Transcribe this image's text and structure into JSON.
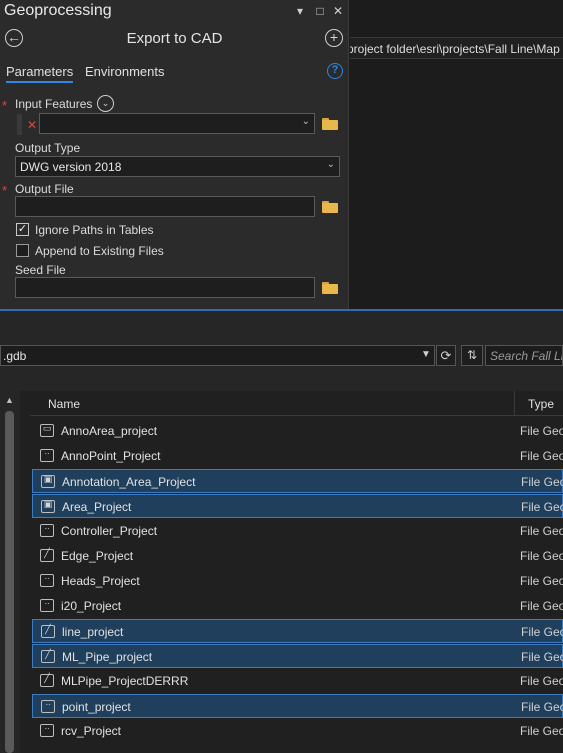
{
  "geoprocessing": {
    "title": "Geoprocessing",
    "tool_name": "Export to CAD",
    "tabs": [
      "Parameters",
      "Environments"
    ],
    "params": {
      "input_features_label": "Input Features",
      "output_type_label": "Output Type",
      "output_type_value": "DWG version 2018",
      "output_file_label": "Output File",
      "ignore_paths_label": "Ignore Paths in Tables",
      "ignore_paths_checked": true,
      "append_label": "Append to Existing Files",
      "append_checked": false,
      "seed_file_label": "Seed File"
    }
  },
  "map": {
    "path": "project folder\\esri\\projects\\Fall Line\\Map"
  },
  "catalog": {
    "address": ".gdb",
    "search_placeholder": "Search Fall Line",
    "columns": {
      "name": "Name",
      "type": "Type"
    },
    "rows": [
      {
        "name": "AnnoArea_project",
        "type": "File Geo",
        "icon": "polygon-fc-icon",
        "selected": false
      },
      {
        "name": "AnnoPoint_Project",
        "type": "File Geo",
        "icon": "point-fc-icon",
        "selected": false
      },
      {
        "name": "Annotation_Area_Project",
        "type": "File Geo",
        "icon": "annotation-fc-icon",
        "selected": true
      },
      {
        "name": "Area_Project",
        "type": "File Geo",
        "icon": "annotation-fc-icon",
        "selected": true
      },
      {
        "name": "Controller_Project",
        "type": "File Geo",
        "icon": "point-fc-icon",
        "selected": false
      },
      {
        "name": "Edge_Project",
        "type": "File Geo",
        "icon": "line-fc-icon",
        "selected": false
      },
      {
        "name": "Heads_Project",
        "type": "File Geo",
        "icon": "point-fc-icon",
        "selected": false
      },
      {
        "name": "i20_Project",
        "type": "File Geo",
        "icon": "point-fc-icon",
        "selected": false
      },
      {
        "name": "line_project",
        "type": "File Geo",
        "icon": "line-fc-icon",
        "selected": true
      },
      {
        "name": "ML_Pipe_project",
        "type": "File Geo",
        "icon": "line-fc-icon",
        "selected": true
      },
      {
        "name": "MLPipe_ProjectDERRR",
        "type": "File Geo",
        "icon": "line-fc-icon",
        "selected": false
      },
      {
        "name": "point_project",
        "type": "File Geo",
        "icon": "point-fc-icon",
        "selected": true
      },
      {
        "name": "rcv_Project",
        "type": "File Geo",
        "icon": "point-fc-icon",
        "selected": false
      }
    ]
  },
  "colors": {
    "accent": "#2e86de",
    "selection": "#1f3f5c",
    "required": "#e0463c"
  }
}
